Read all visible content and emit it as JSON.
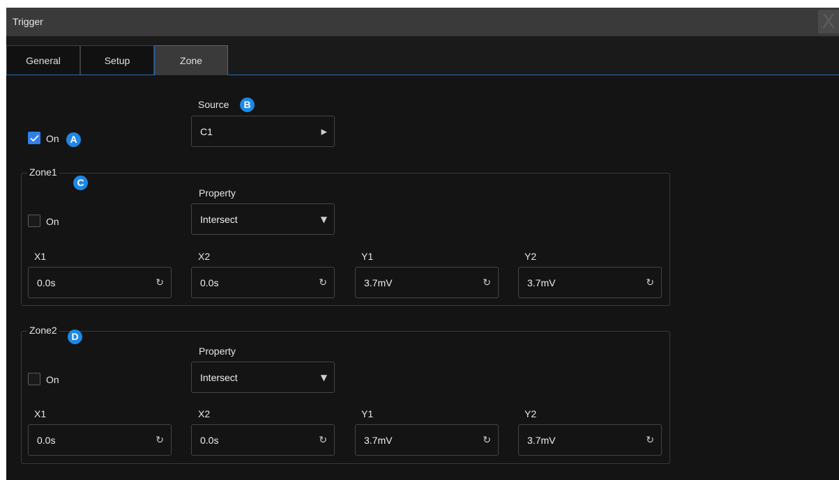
{
  "window": {
    "title": "Trigger",
    "close_label": "X"
  },
  "tabs": [
    {
      "label": "General"
    },
    {
      "label": "Setup"
    },
    {
      "label": "Zone"
    }
  ],
  "zone": {
    "on_label": "On",
    "on_checked": true,
    "source": {
      "label": "Source",
      "value": "C1"
    },
    "badges": [
      "A",
      "B",
      "C",
      "D"
    ],
    "zone1": {
      "title": "Zone1",
      "on_label": "On",
      "on_checked": false,
      "property_label": "Property",
      "property_value": "Intersect",
      "x1_label": "X1",
      "x1_value": "0.0s",
      "x2_label": "X2",
      "x2_value": "0.0s",
      "y1_label": "Y1",
      "y1_value": "3.7mV",
      "y2_label": "Y2",
      "y2_value": "3.7mV"
    },
    "zone2": {
      "title": "Zone2",
      "on_label": "On",
      "on_checked": false,
      "property_label": "Property",
      "property_value": "Intersect",
      "x1_label": "X1",
      "x1_value": "0.0s",
      "x2_label": "X2",
      "x2_value": "0.0s",
      "y1_label": "Y1",
      "y1_value": "3.7mV",
      "y2_label": "Y2",
      "y2_value": "3.7mV"
    }
  },
  "colors": {
    "accent": "#2f80ed",
    "badge": "#1e88e5",
    "background": "#141414"
  }
}
